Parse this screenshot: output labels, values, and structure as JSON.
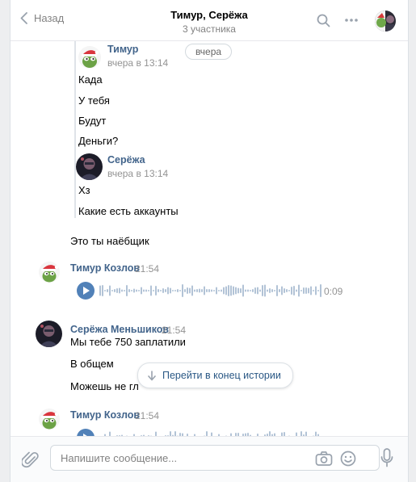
{
  "header": {
    "back_label": "Назад",
    "title": "Тимур, Серёжа",
    "subtitle": "3 участника"
  },
  "date_divider": "вчера",
  "forwarded": [
    {
      "author": "Тимур",
      "time": "вчера в 13:14",
      "lines": [
        "Када",
        "У тебя",
        "Будут",
        "Деньги?"
      ]
    },
    {
      "author": "Серёжа",
      "time": "вчера в 13:14",
      "lines": [
        "Хз",
        "Какие есть аккаунты"
      ]
    }
  ],
  "messages": [
    {
      "text": "Это ты наёбщик"
    },
    {
      "author": "Тимур Козлов",
      "time": "21:54",
      "voice_duration": "0:09"
    },
    {
      "author": "Серёжа Меньшиков",
      "time": "21:54",
      "lines": [
        "Мы тебе 750 заплатили",
        "В общем",
        "Можешь не гл"
      ]
    },
    {
      "author": "Тимур Козлов",
      "time": "21:54"
    }
  ],
  "jump_button": "Перейти в конец истории",
  "composer": {
    "placeholder": "Напишите сообщение..."
  },
  "colors": {
    "accent": "#5181b8",
    "link": "#42648b",
    "background": "#edeef0"
  },
  "icons": [
    "chevron-left-icon",
    "search-icon",
    "more-icon",
    "paperclip-icon",
    "camera-icon",
    "smile-icon",
    "microphone-icon",
    "arrow-down-icon",
    "play-icon"
  ]
}
